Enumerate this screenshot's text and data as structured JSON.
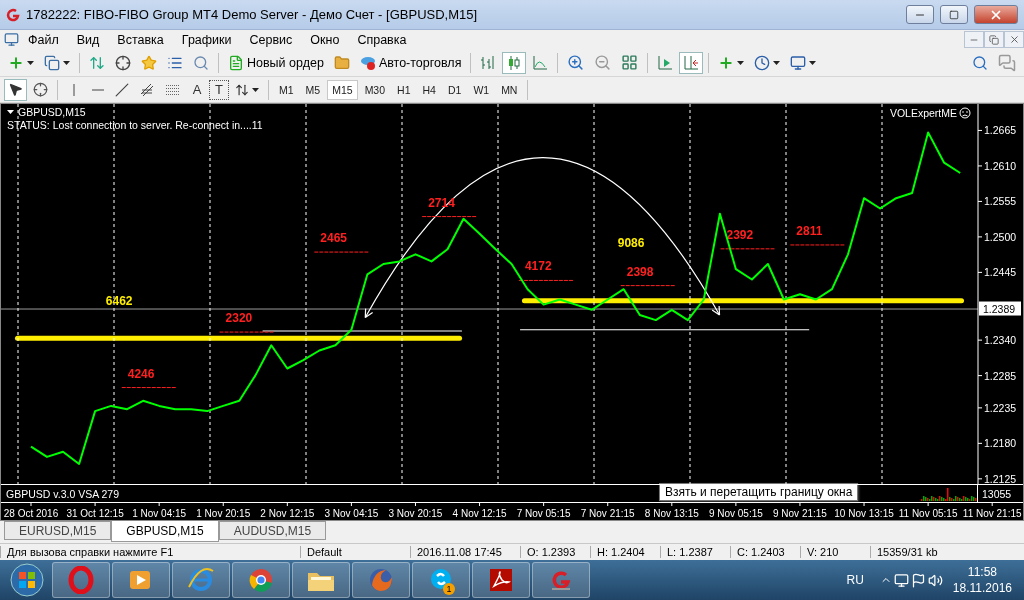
{
  "window": {
    "title": "1782222: FIBO-FIBO Group MT4 Demo Server - Демо Счет - [GBPUSD,M15]"
  },
  "menu": [
    "Файл",
    "Вид",
    "Вставка",
    "Графики",
    "Сервис",
    "Окно",
    "Справка"
  ],
  "toolbar": {
    "order_button": "Новый ордер",
    "autotrading_button": "Авто-торговля",
    "chart_modes": [
      {
        "kind": "bars",
        "selected": false
      },
      {
        "kind": "candles",
        "selected": true
      },
      {
        "kind": "line",
        "selected": false
      }
    ],
    "auto_scroll": false,
    "chart_shift": true
  },
  "drawing_tools": {
    "cursor_selected": true,
    "text_tool": "A",
    "label_tool": "T"
  },
  "timeframes": [
    {
      "label": "M1",
      "selected": false
    },
    {
      "label": "M5",
      "selected": false
    },
    {
      "label": "M15",
      "selected": true
    },
    {
      "label": "M30",
      "selected": false
    },
    {
      "label": "H1",
      "selected": false
    },
    {
      "label": "H4",
      "selected": false
    },
    {
      "label": "D1",
      "selected": false
    },
    {
      "label": "W1",
      "selected": false
    },
    {
      "label": "MN",
      "selected": false
    }
  ],
  "chart": {
    "symbol": "GBPUSD,M15",
    "status": "STATUS:  Lost connection to server. Re-connect in....11",
    "expert": "VOLExpertME",
    "indicator": {
      "name": "GBPUSD v.3.0 VSA 279",
      "scale": "13055"
    },
    "tooltip": "Взять и перетащить границу окна",
    "chart_data": {
      "type": "line",
      "ylim": [
        1.2117,
        1.2706
      ],
      "grid": true,
      "categories": [
        "28 Oct 2016",
        null,
        null,
        null,
        "31 Oct 12:15",
        null,
        null,
        null,
        "1 Nov 04:15",
        null,
        null,
        null,
        "1 Nov 20:15",
        null,
        null,
        null,
        "2 Nov 12:15",
        null,
        null,
        null,
        "3 Nov 04:15",
        null,
        null,
        null,
        "3 Nov 20:15",
        null,
        null,
        null,
        "4 Nov 12:15",
        null,
        null,
        null,
        "7 Nov 05:15",
        null,
        null,
        null,
        "7 Nov 21:15",
        null,
        null,
        null,
        "8 Nov 13:15",
        null,
        null,
        null,
        "9 Nov 05:15",
        null,
        null,
        null,
        "9 Nov 21:15",
        null,
        null,
        null,
        "10 Nov 13:15",
        null,
        null,
        null,
        "11 Nov 05:15",
        null,
        null,
        null,
        "11 Nov 21:15"
      ],
      "series": [
        {
          "color": "#00ff00",
          "values": [
            1.2175,
            1.2159,
            1.2167,
            1.2148,
            1.223,
            1.2238,
            1.2233,
            1.2246,
            1.2238,
            1.2233,
            1.2233,
            1.223,
            1.2238,
            1.2246,
            1.2285,
            1.2332,
            1.2296,
            1.2309,
            1.2324,
            1.2332,
            1.2356,
            1.2442,
            1.2458,
            1.2462,
            1.2473,
            1.2462,
            1.2481,
            1.2528,
            1.2505,
            1.2481,
            1.2458,
            1.2419,
            1.2395,
            1.2403,
            1.2395,
            1.2387,
            1.2403,
            1.2419,
            1.2379,
            1.2371,
            1.2387,
            1.2371,
            1.2403,
            1.2536,
            1.245,
            1.2434,
            1.2458,
            1.2403,
            1.2411,
            1.2403,
            1.2419,
            1.2473,
            1.256,
            1.2544,
            1.256,
            1.2568,
            1.2662,
            1.2615,
            1.2599,
            null,
            null
          ]
        }
      ],
      "yticks": [
        {
          "value": 1.2665,
          "label": "1.2665"
        },
        {
          "value": 1.261,
          "label": "1.2610"
        },
        {
          "value": 1.2555,
          "label": "1.2555"
        },
        {
          "value": 1.25,
          "label": "1.2500"
        },
        {
          "value": 1.2445,
          "label": "1.2445"
        },
        {
          "value": 1.234,
          "label": "1.2340"
        },
        {
          "value": 1.2285,
          "label": "1.2285"
        },
        {
          "value": 1.2235,
          "label": "1.2235"
        },
        {
          "value": 1.218,
          "label": "1.2180"
        },
        {
          "value": 1.2125,
          "label": "1.2125"
        }
      ]
    },
    "bid_label": "1.2389",
    "overlays": [
      {
        "kind": "arc"
      },
      {
        "kind": "label",
        "text": "6462",
        "color": "#ffee00"
      },
      {
        "kind": "volume-label",
        "text": "4246",
        "color": "#ff2020"
      },
      {
        "kind": "volume-label",
        "text": "2320",
        "color": "#ff2020"
      },
      {
        "kind": "volume-label",
        "text": "2465",
        "color": "#ff2020"
      },
      {
        "kind": "volume-label",
        "text": "2714",
        "color": "#ff2020"
      },
      {
        "kind": "volume-label",
        "text": "4172",
        "color": "#ff2020"
      },
      {
        "kind": "label",
        "text": "9086",
        "color": "#ffee00"
      },
      {
        "kind": "volume-label",
        "text": "2398",
        "color": "#ff2020"
      },
      {
        "kind": "volume-label",
        "text": "2392",
        "color": "#ff2020"
      },
      {
        "kind": "volume-label",
        "text": "2811",
        "color": "#ff2020"
      }
    ]
  },
  "chart_tabs": [
    {
      "label": "EURUSD,M15",
      "selected": false
    },
    {
      "label": "GBPUSD,M15",
      "selected": true
    },
    {
      "label": "AUDUSD,M15",
      "selected": false
    }
  ],
  "status_bar": [
    "Для вызова справки нажмите F1",
    "Default",
    "2016.11.08 17:45",
    "O: 1.2393",
    "H: 1.2404",
    "L: 1.2387",
    "C: 1.2403",
    "V: 210",
    "15359/31 kb"
  ],
  "taskbar": {
    "apps": [
      {
        "kind": "opera"
      },
      {
        "kind": "media"
      },
      {
        "kind": "ie"
      },
      {
        "kind": "chrome"
      },
      {
        "kind": "folder"
      },
      {
        "kind": "firefox"
      },
      {
        "kind": "skype",
        "badge": "1"
      },
      {
        "kind": "acrobat"
      },
      {
        "kind": "fibo"
      }
    ],
    "language": "RU",
    "time": "11:58",
    "date": "18.11.2016"
  }
}
